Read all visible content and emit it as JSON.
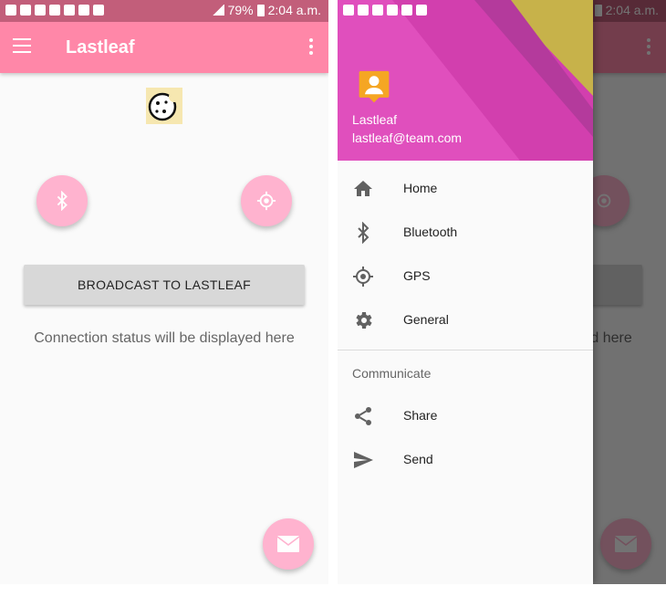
{
  "status_bar": {
    "battery": "79%",
    "time": "2:04 a.m."
  },
  "app": {
    "title": "Lastleaf"
  },
  "main": {
    "broadcast_button": "BROADCAST TO LASTLEAF",
    "connection_status": "Connection status will be displayed here"
  },
  "drawer": {
    "user_name": "Lastleaf",
    "user_email": "lastleaf@team.com",
    "items": [
      {
        "label": "Home",
        "icon": "home-icon"
      },
      {
        "label": "Bluetooth",
        "icon": "bluetooth-icon"
      },
      {
        "label": "GPS",
        "icon": "gps-icon"
      },
      {
        "label": "General",
        "icon": "gear-icon"
      }
    ],
    "section_title": "Communicate",
    "communicate_items": [
      {
        "label": "Share",
        "icon": "share-icon"
      },
      {
        "label": "Send",
        "icon": "send-icon"
      }
    ]
  },
  "colors": {
    "status_bar": "#c25e7a",
    "toolbar": "#ff87a8",
    "fab": "#ffb3cf",
    "drawer_header": "#e551c0"
  }
}
